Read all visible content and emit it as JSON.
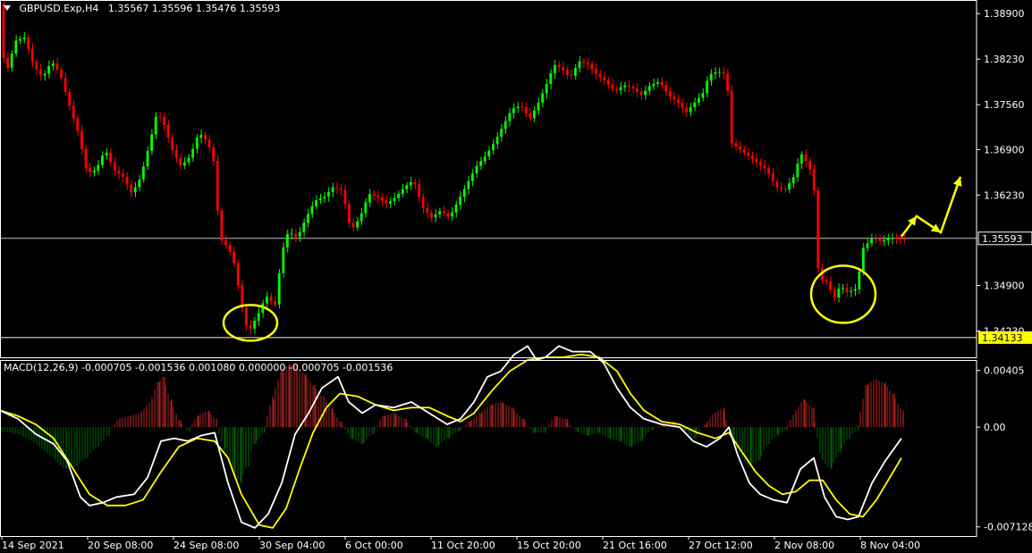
{
  "header": {
    "menu_icon": "triangle-down-icon",
    "symbol": "GBPUSD.Exp,H4",
    "ohlc": "1.35567 1.35596 1.35476 1.35593"
  },
  "macd_header": "MACD(12,26,9) -0.000705 -0.001536 0.001080 0.000000 -0.000705 -0.001536",
  "colors": {
    "background": "#000000",
    "frame": "#ffffff",
    "bull": "#00ff00",
    "bear": "#ff0000",
    "hist_pos": "#b22222",
    "hist_neg": "#006400",
    "macd_line": "#ffffff",
    "signal_line": "#ffff00",
    "circle": "#ffff00",
    "arrow": "#ffff00",
    "level_line": "#c0c0c0"
  },
  "chart_data": [
    {
      "type": "candlestick",
      "title": "GBPUSD.Exp,H4",
      "y_ticks": [
        "1.38900",
        "1.38230",
        "1.37560",
        "1.36900",
        "1.36230",
        "1.35593",
        "1.34900",
        "1.34230",
        "1.34133"
      ],
      "ylim": [
        1.34,
        1.391
      ],
      "current_price": "1.35593",
      "support_level": "1.34133",
      "x_ticks": [
        "14 Sep 2021",
        "20 Sep 08:00",
        "24 Sep 08:00",
        "30 Sep 04:00",
        "6 Oct 00:00",
        "11 Oct 20:00",
        "15 Oct 20:00",
        "21 Oct 16:00",
        "27 Oct 12:00",
        "2 Nov 08:00",
        "8 Nov 04:00"
      ],
      "price_path": [
        [
          0,
          1.3905
        ],
        [
          3,
          1.3845
        ],
        [
          10,
          1.3805
        ],
        [
          20,
          1.385
        ],
        [
          30,
          1.3855
        ],
        [
          40,
          1.3815
        ],
        [
          50,
          1.3795
        ],
        [
          60,
          1.382
        ],
        [
          70,
          1.38
        ],
        [
          80,
          1.3755
        ],
        [
          90,
          1.3715
        ],
        [
          100,
          1.3655
        ],
        [
          110,
          1.366
        ],
        [
          120,
          1.369
        ],
        [
          130,
          1.366
        ],
        [
          140,
          1.365
        ],
        [
          150,
          1.3625
        ],
        [
          160,
          1.365
        ],
        [
          170,
          1.37
        ],
        [
          178,
          1.3745
        ],
        [
          185,
          1.373
        ],
        [
          195,
          1.369
        ],
        [
          205,
          1.3665
        ],
        [
          215,
          1.368
        ],
        [
          225,
          1.3715
        ],
        [
          235,
          1.37
        ],
        [
          242,
          1.367
        ],
        [
          248,
          1.356
        ],
        [
          258,
          1.3545
        ],
        [
          265,
          1.352
        ],
        [
          272,
          1.3465
        ],
        [
          280,
          1.342
        ],
        [
          292,
          1.345
        ],
        [
          300,
          1.3475
        ],
        [
          310,
          1.346
        ],
        [
          318,
          1.354
        ],
        [
          325,
          1.357
        ],
        [
          335,
          1.356
        ],
        [
          345,
          1.359
        ],
        [
          355,
          1.3615
        ],
        [
          365,
          1.362
        ],
        [
          375,
          1.3635
        ],
        [
          385,
          1.363
        ],
        [
          395,
          1.357
        ],
        [
          405,
          1.359
        ],
        [
          415,
          1.3625
        ],
        [
          425,
          1.362
        ],
        [
          435,
          1.361
        ],
        [
          445,
          1.362
        ],
        [
          455,
          1.3635
        ],
        [
          465,
          1.3645
        ],
        [
          475,
          1.3605
        ],
        [
          485,
          1.359
        ],
        [
          495,
          1.36
        ],
        [
          505,
          1.359
        ],
        [
          515,
          1.3615
        ],
        [
          525,
          1.364
        ],
        [
          535,
          1.3665
        ],
        [
          545,
          1.368
        ],
        [
          555,
          1.37
        ],
        [
          565,
          1.3725
        ],
        [
          575,
          1.375
        ],
        [
          585,
          1.3755
        ],
        [
          595,
          1.3735
        ],
        [
          605,
          1.376
        ],
        [
          615,
          1.379
        ],
        [
          622,
          1.3815
        ],
        [
          630,
          1.381
        ],
        [
          640,
          1.3795
        ],
        [
          650,
          1.382
        ],
        [
          660,
          1.3815
        ],
        [
          670,
          1.38
        ],
        [
          680,
          1.379
        ],
        [
          690,
          1.3775
        ],
        [
          700,
          1.3785
        ],
        [
          710,
          1.378
        ],
        [
          720,
          1.377
        ],
        [
          730,
          1.3785
        ],
        [
          740,
          1.379
        ],
        [
          750,
          1.377
        ],
        [
          760,
          1.376
        ],
        [
          770,
          1.3745
        ],
        [
          780,
          1.376
        ],
        [
          790,
          1.3775
        ],
        [
          795,
          1.38
        ],
        [
          805,
          1.3805
        ],
        [
          815,
          1.38
        ],
        [
          820,
          1.37
        ],
        [
          830,
          1.369
        ],
        [
          840,
          1.368
        ],
        [
          850,
          1.367
        ],
        [
          860,
          1.366
        ],
        [
          870,
          1.3635
        ],
        [
          880,
          1.363
        ],
        [
          890,
          1.365
        ],
        [
          898,
          1.3685
        ],
        [
          905,
          1.367
        ],
        [
          912,
          1.365
        ],
        [
          918,
          1.35
        ],
        [
          928,
          1.3495
        ],
        [
          935,
          1.347
        ],
        [
          942,
          1.349
        ],
        [
          950,
          1.348
        ],
        [
          960,
          1.3485
        ],
        [
          968,
          1.3545
        ],
        [
          978,
          1.356
        ],
        [
          988,
          1.3555
        ],
        [
          998,
          1.356
        ],
        [
          1010,
          1.3558
        ]
      ],
      "highlight_circles": [
        {
          "center": [
            280,
            1.3435
          ],
          "radius_x": 30,
          "radius_y": 20
        },
        {
          "center": [
            943,
            1.3477
          ],
          "radius_x": 36,
          "radius_y": 32
        }
      ],
      "arrow_path": [
        [
          1008,
          1.3562
        ],
        [
          1025,
          1.3592
        ],
        [
          1052,
          1.3568
        ],
        [
          1074,
          1.365
        ]
      ]
    },
    {
      "type": "macd",
      "params": "MACD(12,26,9)",
      "y_ticks": [
        "0.00405",
        "0.00",
        "-0.007128"
      ],
      "ylim": [
        -0.0074,
        0.0048
      ],
      "histogram": [
        [
          0,
          -0.0003
        ],
        [
          12,
          -0.0004
        ],
        [
          24,
          -0.0006
        ],
        [
          36,
          -0.001
        ],
        [
          48,
          -0.0016
        ],
        [
          60,
          -0.0022
        ],
        [
          72,
          -0.003
        ],
        [
          84,
          -0.0028
        ],
        [
          96,
          -0.0022
        ],
        [
          108,
          -0.0014
        ],
        [
          120,
          -0.0006
        ],
        [
          132,
          0.0006
        ],
        [
          144,
          0.0008
        ],
        [
          156,
          0.001
        ],
        [
          168,
          0.0018
        ],
        [
          176,
          0.0032
        ],
        [
          182,
          0.0036
        ],
        [
          190,
          0.002
        ],
        [
          200,
          0.0005
        ],
        [
          210,
          -0.0003
        ],
        [
          220,
          0.0008
        ],
        [
          232,
          0.0012
        ],
        [
          240,
          0.0006
        ],
        [
          250,
          -0.0015
        ],
        [
          260,
          -0.0032
        ],
        [
          268,
          -0.004
        ],
        [
          276,
          -0.0028
        ],
        [
          284,
          -0.0012
        ],
        [
          294,
          -0.0004
        ],
        [
          304,
          0.002
        ],
        [
          314,
          0.004
        ],
        [
          322,
          0.0045
        ],
        [
          330,
          0.0044
        ],
        [
          340,
          0.0038
        ],
        [
          350,
          0.003
        ],
        [
          360,
          0.0022
        ],
        [
          370,
          0.0014
        ],
        [
          380,
          0.0004
        ],
        [
          392,
          -0.0008
        ],
        [
          404,
          -0.0012
        ],
        [
          416,
          -0.0005
        ],
        [
          428,
          0.0008
        ],
        [
          440,
          0.001
        ],
        [
          452,
          0.0006
        ],
        [
          464,
          -0.0004
        ],
        [
          476,
          -0.0008
        ],
        [
          488,
          -0.0014
        ],
        [
          500,
          -0.0008
        ],
        [
          512,
          -0.0003
        ],
        [
          524,
          0.0004
        ],
        [
          536,
          0.001
        ],
        [
          548,
          0.0016
        ],
        [
          560,
          0.0018
        ],
        [
          572,
          0.0014
        ],
        [
          584,
          0.0006
        ],
        [
          596,
          -0.0004
        ],
        [
          608,
          -0.0004
        ],
        [
          620,
          0.0008
        ],
        [
          632,
          0.0006
        ],
        [
          644,
          -0.0003
        ],
        [
          656,
          -0.0006
        ],
        [
          668,
          -0.0004
        ],
        [
          680,
          -0.0008
        ],
        [
          692,
          -0.001
        ],
        [
          704,
          -0.0014
        ],
        [
          716,
          -0.001
        ],
        [
          728,
          -0.0002
        ],
        [
          740,
          0.0002
        ],
        [
          752,
          0.0004
        ],
        [
          764,
          -0.0002
        ],
        [
          776,
          -0.0008
        ],
        [
          788,
          0.0002
        ],
        [
          798,
          0.001
        ],
        [
          808,
          0.0014
        ],
        [
          818,
          -0.0008
        ],
        [
          828,
          -0.002
        ],
        [
          838,
          -0.0028
        ],
        [
          848,
          -0.0024
        ],
        [
          858,
          -0.0012
        ],
        [
          868,
          -0.0006
        ],
        [
          878,
          -0.0002
        ],
        [
          888,
          0.001
        ],
        [
          898,
          0.002
        ],
        [
          908,
          0.0014
        ],
        [
          918,
          -0.0022
        ],
        [
          928,
          -0.003
        ],
        [
          938,
          -0.0018
        ],
        [
          948,
          -0.0008
        ],
        [
          958,
          -0.0002
        ],
        [
          968,
          0.003
        ],
        [
          978,
          0.0034
        ],
        [
          988,
          0.0032
        ],
        [
          998,
          0.0024
        ],
        [
          1008,
          0.0012
        ]
      ],
      "macd_line": [
        [
          0,
          0.0012
        ],
        [
          20,
          0.0006
        ],
        [
          40,
          -0.0005
        ],
        [
          60,
          -0.0012
        ],
        [
          75,
          -0.0024
        ],
        [
          90,
          -0.005
        ],
        [
          100,
          -0.0056
        ],
        [
          115,
          -0.0054
        ],
        [
          130,
          -0.005
        ],
        [
          150,
          -0.0048
        ],
        [
          165,
          -0.0036
        ],
        [
          180,
          -0.001
        ],
        [
          195,
          -0.0008
        ],
        [
          210,
          -0.001
        ],
        [
          225,
          -0.0006
        ],
        [
          240,
          -0.0004
        ],
        [
          255,
          -0.004
        ],
        [
          270,
          -0.0068
        ],
        [
          285,
          -0.0072
        ],
        [
          300,
          -0.0062
        ],
        [
          315,
          -0.004
        ],
        [
          330,
          -0.0005
        ],
        [
          345,
          0.001
        ],
        [
          360,
          0.0028
        ],
        [
          378,
          0.0036
        ],
        [
          390,
          0.0018
        ],
        [
          405,
          0.001
        ],
        [
          420,
          0.0016
        ],
        [
          440,
          0.0014
        ],
        [
          460,
          0.0018
        ],
        [
          480,
          0.001
        ],
        [
          500,
          0.0002
        ],
        [
          515,
          0.0006
        ],
        [
          530,
          0.0018
        ],
        [
          545,
          0.0036
        ],
        [
          560,
          0.004
        ],
        [
          575,
          0.0052
        ],
        [
          590,
          0.0058
        ],
        [
          600,
          0.0048
        ],
        [
          610,
          0.005
        ],
        [
          625,
          0.0058
        ],
        [
          640,
          0.0054
        ],
        [
          660,
          0.0054
        ],
        [
          675,
          0.0046
        ],
        [
          690,
          0.0028
        ],
        [
          705,
          0.0014
        ],
        [
          720,
          0.0006
        ],
        [
          740,
          0.0002
        ],
        [
          760,
          0.0
        ],
        [
          775,
          -0.001
        ],
        [
          790,
          -0.0014
        ],
        [
          805,
          -0.0008
        ],
        [
          815,
          0.0
        ],
        [
          825,
          -0.002
        ],
        [
          838,
          -0.004
        ],
        [
          850,
          -0.0048
        ],
        [
          865,
          -0.0052
        ],
        [
          880,
          -0.0054
        ],
        [
          895,
          -0.003
        ],
        [
          910,
          -0.0022
        ],
        [
          922,
          -0.005
        ],
        [
          935,
          -0.0064
        ],
        [
          948,
          -0.0066
        ],
        [
          960,
          -0.0064
        ],
        [
          975,
          -0.004
        ],
        [
          990,
          -0.0024
        ],
        [
          1008,
          -0.0008
        ]
      ],
      "signal_line": [
        [
          0,
          0.0012
        ],
        [
          20,
          0.0008
        ],
        [
          40,
          0.0002
        ],
        [
          60,
          -0.0008
        ],
        [
          80,
          -0.0028
        ],
        [
          100,
          -0.0048
        ],
        [
          120,
          -0.0056
        ],
        [
          140,
          -0.0056
        ],
        [
          160,
          -0.0052
        ],
        [
          180,
          -0.0032
        ],
        [
          200,
          -0.0014
        ],
        [
          220,
          -0.0008
        ],
        [
          240,
          -0.001
        ],
        [
          255,
          -0.0022
        ],
        [
          270,
          -0.0048
        ],
        [
          290,
          -0.007
        ],
        [
          305,
          -0.0072
        ],
        [
          320,
          -0.0058
        ],
        [
          335,
          -0.003
        ],
        [
          350,
          -0.0004
        ],
        [
          365,
          0.0014
        ],
        [
          380,
          0.0024
        ],
        [
          400,
          0.0022
        ],
        [
          420,
          0.0016
        ],
        [
          440,
          0.0012
        ],
        [
          460,
          0.0014
        ],
        [
          480,
          0.0014
        ],
        [
          500,
          0.0008
        ],
        [
          515,
          0.0004
        ],
        [
          530,
          0.001
        ],
        [
          550,
          0.0026
        ],
        [
          570,
          0.004
        ],
        [
          590,
          0.0048
        ],
        [
          610,
          0.005
        ],
        [
          630,
          0.005
        ],
        [
          650,
          0.0052
        ],
        [
          670,
          0.005
        ],
        [
          690,
          0.004
        ],
        [
          705,
          0.0024
        ],
        [
          720,
          0.0012
        ],
        [
          740,
          0.0004
        ],
        [
          760,
          0.0002
        ],
        [
          780,
          -0.0004
        ],
        [
          800,
          -0.0008
        ],
        [
          815,
          -0.0004
        ],
        [
          830,
          -0.0018
        ],
        [
          845,
          -0.0032
        ],
        [
          860,
          -0.0042
        ],
        [
          875,
          -0.0048
        ],
        [
          890,
          -0.0046
        ],
        [
          905,
          -0.0038
        ],
        [
          920,
          -0.0038
        ],
        [
          935,
          -0.0052
        ],
        [
          950,
          -0.0062
        ],
        [
          965,
          -0.0064
        ],
        [
          980,
          -0.0052
        ],
        [
          995,
          -0.0036
        ],
        [
          1008,
          -0.0022
        ]
      ]
    }
  ]
}
